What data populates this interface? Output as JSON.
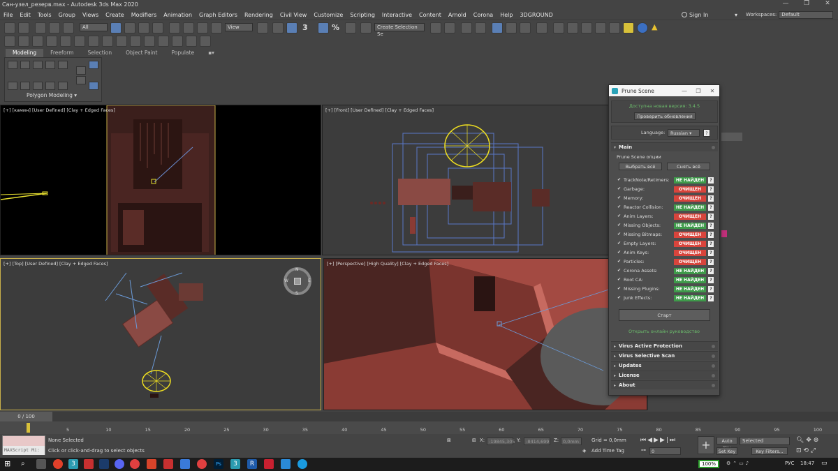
{
  "window": {
    "title": "Сан-узел_резерв.max - Autodesk 3ds Max 2020",
    "controls": [
      "—",
      "❐",
      "✕"
    ]
  },
  "menu": [
    "File",
    "Edit",
    "Tools",
    "Group",
    "Views",
    "Create",
    "Modifiers",
    "Animation",
    "Graph Editors",
    "Rendering",
    "Civil View",
    "Customize",
    "Scripting",
    "Interactive",
    "Content",
    "Arnold",
    "Corona",
    "Help",
    "3DGROUND"
  ],
  "signin": {
    "label": "Sign In"
  },
  "workspace": {
    "label": "Workspaces:",
    "value": "Default"
  },
  "toolbar": {
    "filter": "All",
    "view": "View",
    "percent": "%",
    "snap": "3",
    "selection_set": "Create Selection Se"
  },
  "ribbon": {
    "tabs": [
      "Modeling",
      "Freeform",
      "Selection",
      "Object Paint",
      "Populate"
    ],
    "panel_label": "Polygon Modeling ▾"
  },
  "viewports": {
    "top_left": "[+] [камин] [User Defined] [Clay + Edged Faces]",
    "top_right": "[+] [Front] [User Defined] [Clay + Edged Faces]",
    "bottom_left": "[+] [Top] [User Defined] [Clay + Edged Faces]",
    "bottom_right": "[+] [Perspective] [High Quality] [Clay + Edged Faces]"
  },
  "viewcube": {
    "n": "N",
    "s": "S",
    "w": "W",
    "e": "E"
  },
  "prune": {
    "title": "Prune Scene",
    "update_notice": "Доступна новая версия: 3.4.5",
    "check_updates": "Проверить обновления",
    "language_label": "Language:",
    "language_value": "Russian",
    "help": "?",
    "main_header": "Main",
    "options_label": "Prune Scene опции",
    "select_all": "Выбрать всё",
    "deselect_all": "Снять всё",
    "items": [
      {
        "name": "TrackNote/Retimers:",
        "status": "НЕ НАЙДЕН",
        "kind": "ok"
      },
      {
        "name": "Garbage:",
        "status": "ОЧИЩЕН",
        "kind": "clr"
      },
      {
        "name": "Memory:",
        "status": "ОЧИЩЕН",
        "kind": "clr"
      },
      {
        "name": "Reactor Collision:",
        "status": "НЕ НАЙДЕН",
        "kind": "ok"
      },
      {
        "name": "Anim Layers:",
        "status": "ОЧИЩЕН",
        "kind": "clr"
      },
      {
        "name": "Missing Objects:",
        "status": "НЕ НАЙДЕН",
        "kind": "ok"
      },
      {
        "name": "Missing Bitmaps:",
        "status": "ОЧИЩЕН",
        "kind": "clr"
      },
      {
        "name": "Empty Layers:",
        "status": "ОЧИЩЕН",
        "kind": "clr"
      },
      {
        "name": "Anim Keys:",
        "status": "ОЧИЩЕН",
        "kind": "clr"
      },
      {
        "name": "Particles:",
        "status": "ОЧИЩЕН",
        "kind": "clr"
      },
      {
        "name": "Corona Assets:",
        "status": "НЕ НАЙДЕН",
        "kind": "ok"
      },
      {
        "name": "Root CA:",
        "status": "НЕ НАЙДЕН",
        "kind": "ok"
      },
      {
        "name": "Missing Plugins:",
        "status": "НЕ НАЙДЕН",
        "kind": "ok"
      },
      {
        "name": "Junk Effects:",
        "status": "НЕ НАЙДЕН",
        "kind": "ok"
      }
    ],
    "start": "Старт",
    "guide_link": "Открыть онлайн руководство",
    "sections": [
      "Virus Active Protection",
      "Virus Selective Scan",
      "Updates",
      "License",
      "About"
    ]
  },
  "timeline": {
    "frame": "0 / 100",
    "ticks": [
      "5",
      "10",
      "15",
      "20",
      "25",
      "30",
      "35",
      "40",
      "45",
      "50",
      "55",
      "60",
      "65",
      "70",
      "75",
      "80",
      "85",
      "90",
      "95",
      "100"
    ]
  },
  "status": {
    "maxscript": "MAXScript Mi:",
    "none_selected": "None Selected",
    "hint": "Click or click-and-drag to select objects",
    "x_label": "X:",
    "x_value": "-19845,305",
    "y_label": "Y:",
    "y_value": "-8414,699",
    "z_label": "Z:",
    "z_value": "0,0mm",
    "grid": "Grid = 0,0mm",
    "add_time_tag": "Add Time Tag",
    "auto_key": "Auto Key",
    "selected": "Selected",
    "set_key": "Set Key",
    "key_filters": "Key Filters...",
    "frame_value": "0"
  },
  "taskbar": {
    "zoom": "100%",
    "lang": "РУС",
    "time": "18:47"
  },
  "colors": {
    "accent": "#5a7fb5",
    "not_found": "#3e9a4a",
    "cleared": "#d8443c",
    "clay": "#8a3b34"
  }
}
